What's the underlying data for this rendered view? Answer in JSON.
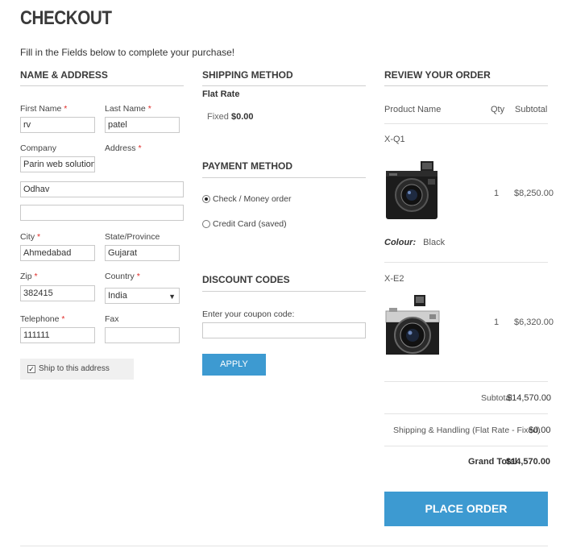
{
  "page": {
    "title": "CHECKOUT",
    "intro": "Fill in the Fields below to complete your purchase!"
  },
  "address": {
    "heading": "NAME & ADDRESS",
    "first_name_label": "First Name",
    "first_name": "rv",
    "last_name_label": "Last Name",
    "last_name": "patel",
    "company_label": "Company",
    "company": "Parin web solutions",
    "address_label": "Address",
    "address_line1": "Odhav",
    "address_line2": "",
    "city_label": "City",
    "city": "Ahmedabad",
    "state_label": "State/Province",
    "state": "Gujarat",
    "zip_label": "Zip",
    "zip": "382415",
    "country_label": "Country",
    "country": "India",
    "telephone_label": "Telephone",
    "telephone": "111111",
    "fax_label": "Fax",
    "fax": "",
    "ship_to_label": "Ship to this address",
    "required_mark": "*"
  },
  "shipping": {
    "heading": "SHIPPING METHOD",
    "method_name": "Flat Rate",
    "fixed_label": "Fixed",
    "fixed_price": "$0.00"
  },
  "payment": {
    "heading": "PAYMENT METHOD",
    "options": [
      "Check / Money order",
      "Credit Card (saved)"
    ]
  },
  "discount": {
    "heading": "DISCOUNT CODES",
    "coupon_label": "Enter your coupon code:",
    "coupon_value": "",
    "apply_label": "APPLY"
  },
  "review": {
    "heading": "REVIEW YOUR ORDER",
    "col_product": "Product Name",
    "col_qty": "Qty",
    "col_subtotal": "Subtotal",
    "items": [
      {
        "name": "X-Q1",
        "qty": "1",
        "subtotal": "$8,250.00",
        "option_label": "Colour:",
        "option_value": "Black"
      },
      {
        "name": "X-E2",
        "qty": "1",
        "subtotal": "$6,320.00"
      }
    ],
    "subtotal_label": "Subtotal",
    "subtotal_value": "$14,570.00",
    "shipping_label": "Shipping & Handling (Flat Rate - Fixed)",
    "shipping_value": "$0.00",
    "grand_total_label": "Grand Total",
    "grand_total_value": "$14,570.00",
    "place_order_label": "PLACE ORDER"
  }
}
